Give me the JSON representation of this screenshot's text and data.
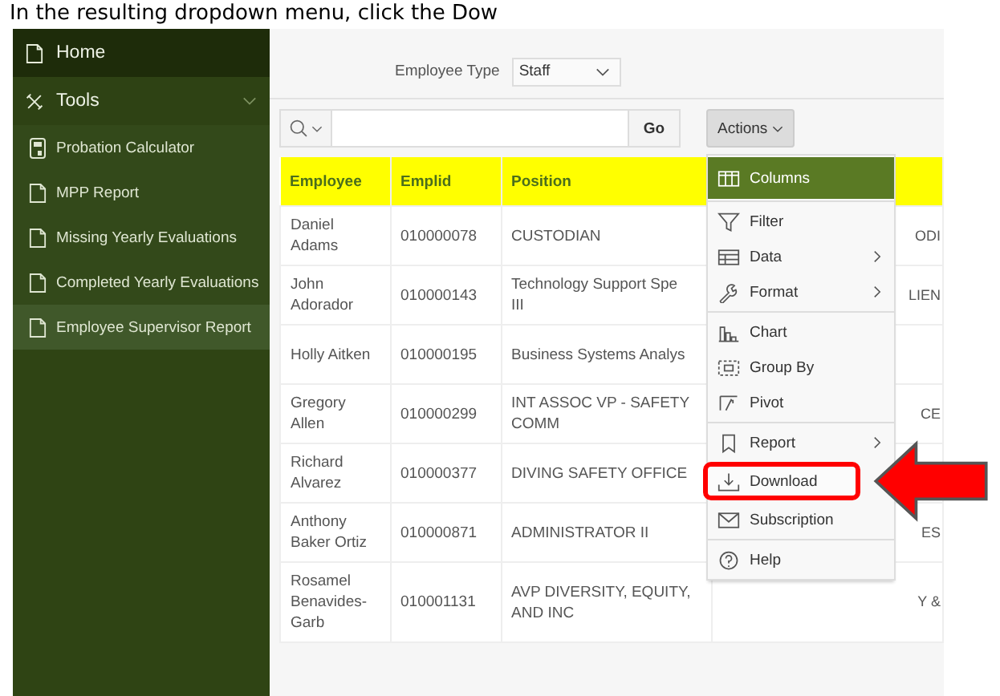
{
  "caption": "In the resulting dropdown menu, click the Dow",
  "sidebar": {
    "items": [
      {
        "label": "Home",
        "kind": "page",
        "selected": false
      },
      {
        "label": "Tools",
        "kind": "tools",
        "selected": false,
        "expanded": true,
        "children": [
          {
            "label": "Probation Calculator",
            "kind": "calculator",
            "selected": false
          },
          {
            "label": "MPP Report",
            "kind": "page",
            "selected": false
          },
          {
            "label": "Missing Yearly Evaluations",
            "kind": "page",
            "selected": false
          },
          {
            "label": "Completed Yearly Evaluations",
            "kind": "page",
            "selected": false
          },
          {
            "label": "Employee Supervisor Report",
            "kind": "page",
            "selected": true
          }
        ]
      }
    ]
  },
  "filter": {
    "label": "Employee Type",
    "value": "Staff"
  },
  "toolbar": {
    "go": "Go",
    "actions": "Actions"
  },
  "table": {
    "columns": [
      "Employee",
      "Emplid",
      "Position"
    ],
    "rows": [
      {
        "employee": "Daniel Adams",
        "emplid": "010000078",
        "position": "CUSTODIAN",
        "column_4": "ODI"
      },
      {
        "employee": "John Adorador",
        "emplid": "010000143",
        "position": "Technology Support Spe\nIII",
        "column_4": "LIEN"
      },
      {
        "employee": "Holly Aitken",
        "emplid": "010000195",
        "position": "Business Systems Analys"
      },
      {
        "employee": "Gregory Allen",
        "emplid": "010000299",
        "position": "INT ASSOC VP - SAFETY\nCOMM",
        "column_4": "CE"
      },
      {
        "employee": "Richard Alvarez",
        "emplid": "010000377",
        "position": "DIVING SAFETY OFFICE"
      },
      {
        "employee": "Anthony Baker Ortiz",
        "emplid": "010000871",
        "position": "ADMINISTRATOR II",
        "column_4": "ES"
      },
      {
        "employee": "Rosamel Benavides-Garb",
        "emplid": "010001131",
        "position": "AVP DIVERSITY, EQUITY,\nAND INC",
        "column_4": "Y &"
      }
    ]
  },
  "menu": {
    "groups": [
      [
        {
          "label": "Columns",
          "kind": "columns",
          "submenu": false,
          "selected": true,
          "highlighted": false
        }
      ],
      [
        {
          "label": "Filter",
          "kind": "filter",
          "submenu": false,
          "selected": false,
          "highlighted": false
        },
        {
          "label": "Data",
          "kind": "data",
          "submenu": true,
          "selected": false,
          "highlighted": false
        },
        {
          "label": "Format",
          "kind": "format",
          "submenu": true,
          "selected": false,
          "highlighted": false
        }
      ],
      [
        {
          "label": "Chart",
          "kind": "chart",
          "submenu": false,
          "selected": false,
          "highlighted": false
        },
        {
          "label": "Group By",
          "kind": "groupby",
          "submenu": false,
          "selected": false,
          "highlighted": false
        },
        {
          "label": "Pivot",
          "kind": "pivot",
          "submenu": false,
          "selected": false,
          "highlighted": false
        }
      ],
      [
        {
          "label": "Report",
          "kind": "report",
          "submenu": true,
          "selected": false,
          "highlighted": false
        },
        {
          "label": "Download",
          "kind": "download",
          "submenu": false,
          "selected": false,
          "highlighted": true
        },
        {
          "label": "Subscription",
          "kind": "subscription",
          "submenu": false,
          "selected": false,
          "highlighted": false
        }
      ],
      [
        {
          "label": "Help",
          "kind": "help",
          "submenu": false,
          "selected": false,
          "highlighted": false
        }
      ]
    ]
  }
}
